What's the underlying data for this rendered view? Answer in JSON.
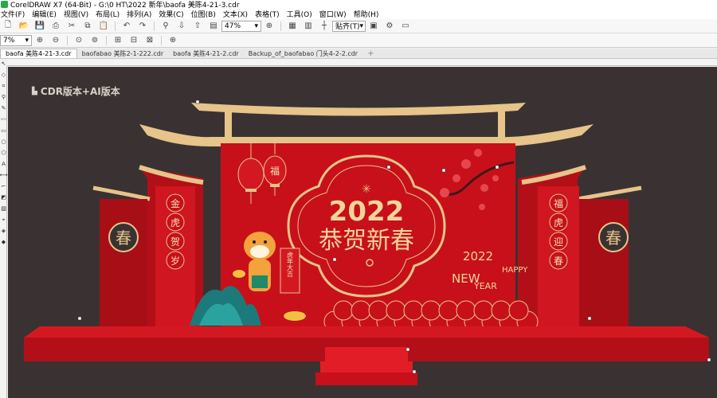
{
  "window": {
    "title": "CorelDRAW X7 (64-Bit) - G:\\0 HT\\2022 新年\\baofa 美陈4-21-3.cdr"
  },
  "menu": {
    "items": [
      "文件(F)",
      "编辑(E)",
      "视图(V)",
      "布局(L)",
      "排列(A)",
      "效果(C)",
      "位图(B)",
      "文本(X)",
      "表格(T)",
      "工具(O)",
      "窗口(W)",
      "帮助(H)"
    ]
  },
  "toolbar": {
    "zoom_value": "47%",
    "snap_label": "贴齐(T)",
    "zoom_left_value": "7%"
  },
  "tabs": [
    {
      "label": "baofa 美陈4-21-3.cdr",
      "active": true
    },
    {
      "label": "baofabao 美陈2-1-222.cdr",
      "active": false
    },
    {
      "label": "baofa 美陈4-21-2.cdr",
      "active": false
    },
    {
      "label": "Backup_of_baofabao 门头4-2-2.cdr",
      "active": false
    }
  ],
  "canvas": {
    "version_label": "CDR版本+AI版本",
    "design": {
      "year": "2022",
      "greeting": "恭贺新春",
      "left_blessing": [
        "金",
        "虎",
        "贺",
        "岁"
      ],
      "right_blessing": [
        "福",
        "虎",
        "迎",
        "春"
      ],
      "spring_char": "春",
      "lantern_char": "福",
      "scroll_text": "虎年大吉",
      "ny_year": "2022",
      "ny_happy": "HAPPY",
      "ny_new": "NEW",
      "ny_year_word": "YEAR"
    }
  },
  "colors": {
    "canvas_bg": "#3a3232",
    "stage_red": "#c8101a",
    "gold": "#e8c98a"
  }
}
